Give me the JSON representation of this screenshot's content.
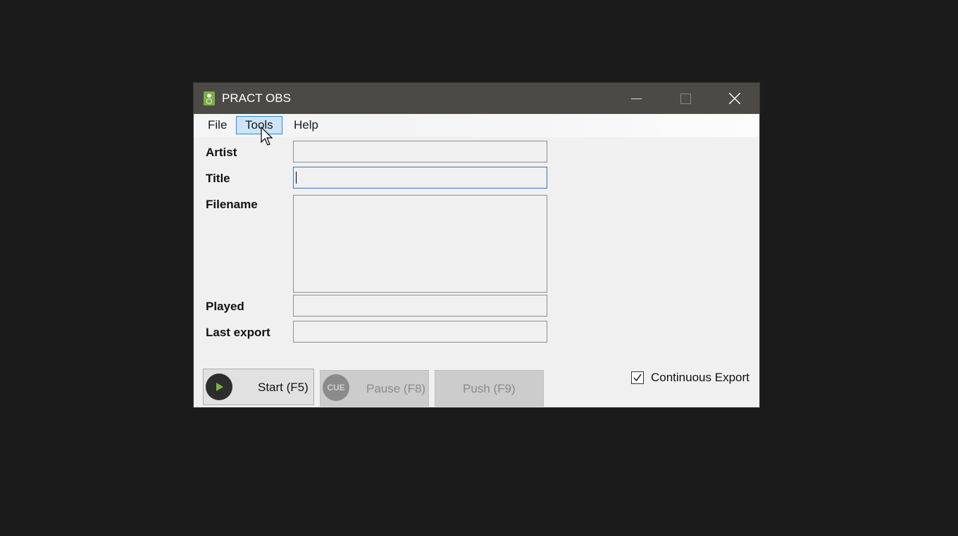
{
  "window": {
    "title": "PRACT OBS",
    "icon": "speaker-icon"
  },
  "menu": {
    "file": "File",
    "tools": "Tools",
    "help": "Help"
  },
  "form": {
    "artist_label": "Artist",
    "title_label": "Title",
    "filename_label": "Filename",
    "played_label": "Played",
    "last_export_label": "Last export",
    "artist_value": "",
    "title_value": "",
    "filename_value": "",
    "played_value": "",
    "last_export_value": ""
  },
  "buttons": {
    "start": "Start (F5)",
    "pause": "Pause (F8)",
    "push": "Push (F9)",
    "cue_badge": "CUE"
  },
  "options": {
    "continuous_export_label": "Continuous Export",
    "continuous_export_checked": true
  },
  "colors": {
    "menu_highlight": "#cce4f7",
    "menu_highlight_border": "#2e8bd5",
    "play_accent": "#79b43a",
    "titlebar": "#4b4a47"
  }
}
